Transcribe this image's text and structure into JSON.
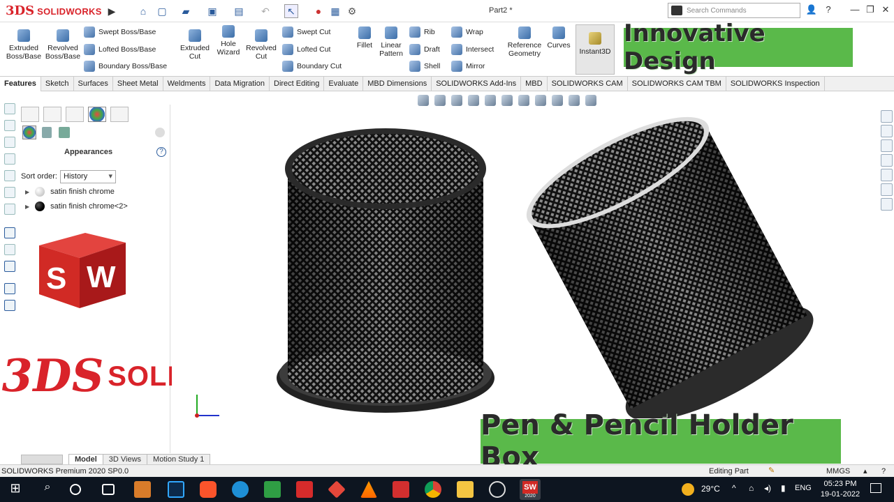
{
  "titlebar": {
    "brand_ds": "3DS",
    "brand_name": "SOLIDWORKS",
    "document_title": "Part2 *",
    "search_placeholder": "Search Commands",
    "help": "?"
  },
  "command_manager": {
    "extruded_boss": "Extruded Boss/Base",
    "revolved_boss": "Revolved Boss/Base",
    "swept_boss": "Swept Boss/Base",
    "lofted_boss": "Lofted Boss/Base",
    "boundary_boss": "Boundary Boss/Base",
    "extruded_cut": "Extruded Cut",
    "hole_wizard": "Hole Wizard",
    "revolved_cut": "Revolved Cut",
    "swept_cut": "Swept Cut",
    "lofted_cut": "Lofted Cut",
    "boundary_cut": "Boundary Cut",
    "fillet": "Fillet",
    "linear_pattern": "Linear Pattern",
    "rib": "Rib",
    "draft": "Draft",
    "shell": "Shell",
    "wrap": "Wrap",
    "intersect": "Intersect",
    "mirror": "Mirror",
    "reference_geometry": "Reference Geometry",
    "curves": "Curves",
    "instant3d": "Instant3D"
  },
  "banners": {
    "top": "Innovative Design",
    "bottom": "Pen & Pencil Holder Box"
  },
  "tabs": [
    "Features",
    "Sketch",
    "Surfaces",
    "Sheet Metal",
    "Weldments",
    "Data Migration",
    "Direct Editing",
    "Evaluate",
    "MBD Dimensions",
    "SOLIDWORKS Add-Ins",
    "MBD",
    "SOLIDWORKS CAM",
    "SOLIDWORKS CAM TBM",
    "SOLIDWORKS Inspection"
  ],
  "feature_manager": {
    "title": "Appearances",
    "sort_label": "Sort order:",
    "sort_value": "History",
    "items": [
      {
        "label": "satin finish chrome",
        "color": "#e8e8e8"
      },
      {
        "label": "satin finish chrome<2>",
        "color": "#111111"
      }
    ]
  },
  "sw_cube": {
    "s": "S",
    "w": "W"
  },
  "big_logo": {
    "ds": "3DS",
    "text": "SOLIDWORKS"
  },
  "bottom_tabs": [
    "Model",
    "3D Views",
    "Motion Study 1"
  ],
  "status": {
    "left": "SOLIDWORKS Premium 2020 SP0.0",
    "mode": "Editing Part",
    "units": "MMGS"
  },
  "taskbar": {
    "temperature": "29°C",
    "language": "ENG",
    "time": "05:23 PM",
    "date": "19-01-2022",
    "sw_badge": "2020"
  },
  "colors": {
    "brand_red": "#d9232a",
    "banner_green": "#5ab94a"
  }
}
